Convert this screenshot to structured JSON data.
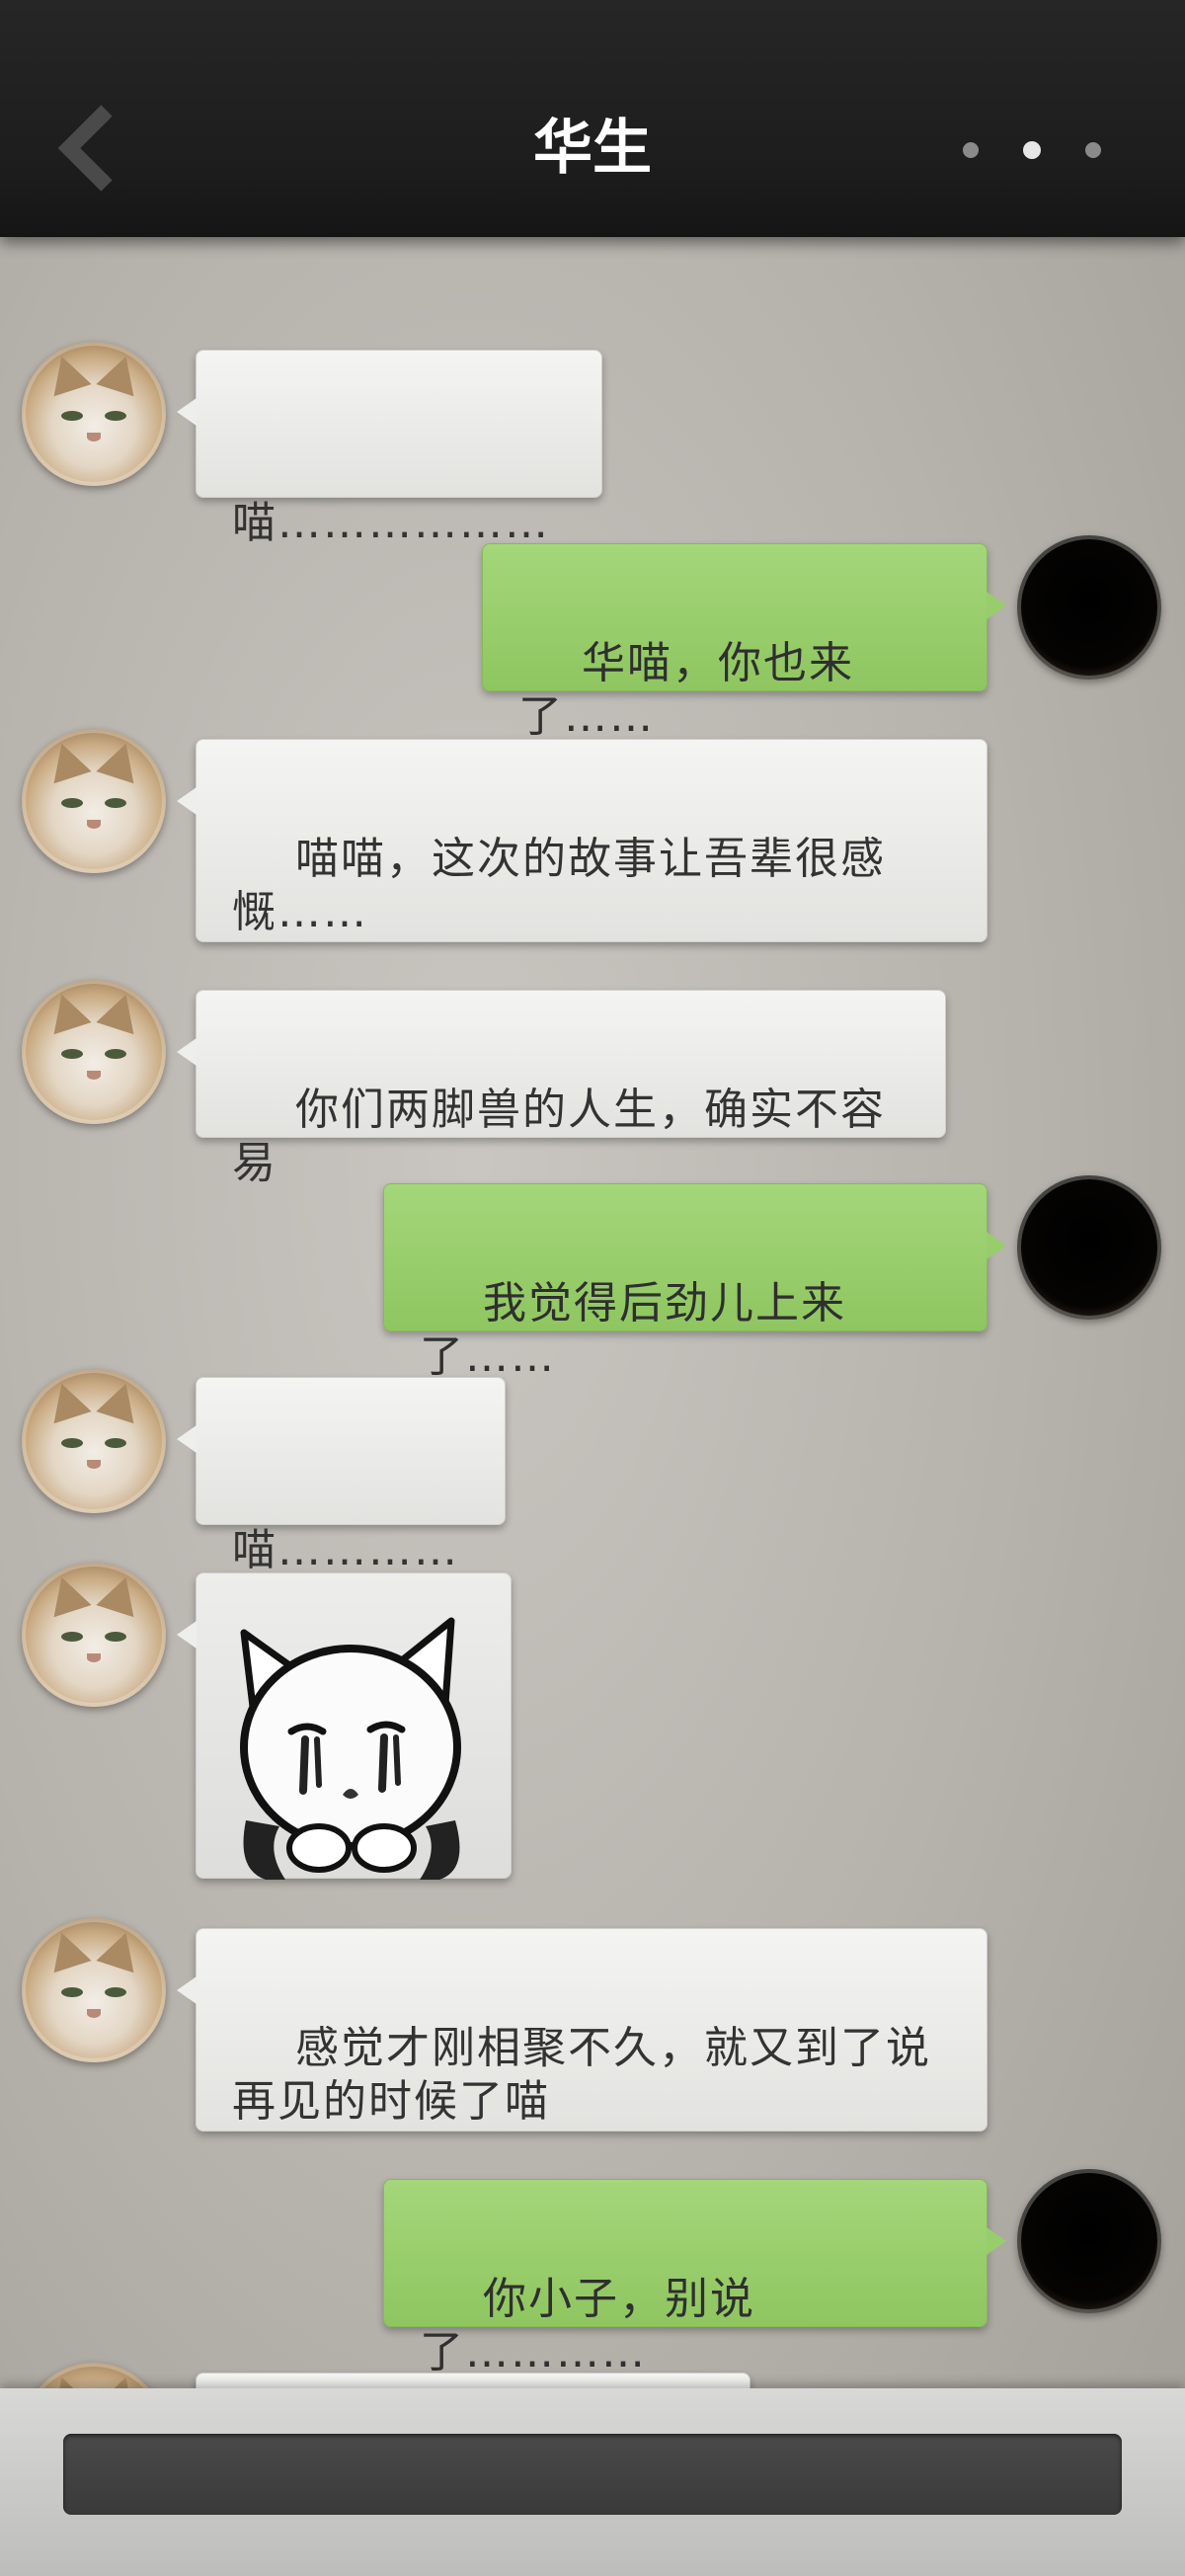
{
  "header": {
    "title": "华生",
    "back_icon": "chevron-left-icon",
    "more_icon": "more-dots-icon"
  },
  "colors": {
    "header_bg": "#1f1f1f",
    "incoming_bubble": "#eeeeec",
    "outgoing_bubble": "#98cd6c",
    "chat_bg": "#b8b4ae",
    "input_bg": "#404040"
  },
  "messages": [
    {
      "side": "left",
      "avatar": "cat-avatar",
      "text": "喵………………"
    },
    {
      "side": "right",
      "avatar": "dark-avatar",
      "text": "华喵，你也来了……"
    },
    {
      "side": "left",
      "avatar": "cat-avatar",
      "text": "喵喵，这次的故事让吾辈很感慨……"
    },
    {
      "side": "left",
      "avatar": "cat-avatar",
      "text": "你们两脚兽的人生，确实不容易"
    },
    {
      "side": "right",
      "avatar": "dark-avatar",
      "text": "我觉得后劲儿上来了……"
    },
    {
      "side": "left",
      "avatar": "cat-avatar",
      "text": "喵…………"
    },
    {
      "side": "left",
      "avatar": "cat-avatar",
      "sticker": "crying-cat-sticker"
    },
    {
      "side": "left",
      "avatar": "cat-avatar",
      "text": "感觉才刚相聚不久，就又到了说再见的时候了喵"
    },
    {
      "side": "right",
      "avatar": "dark-avatar",
      "text": "你小子，别说了…………"
    }
  ],
  "input": {
    "value": "",
    "placeholder": ""
  }
}
